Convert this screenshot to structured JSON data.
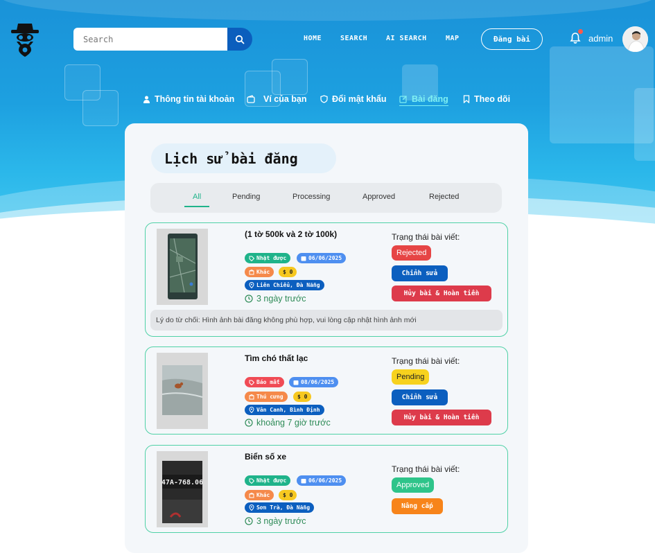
{
  "header": {
    "search_placeholder": "Search",
    "nav": [
      "HOME",
      "SEARCH",
      "AI SEARCH",
      "MAP"
    ],
    "post_button": "Đăng bài",
    "user": "admin"
  },
  "subnav": [
    {
      "label": "Thông tin tài khoản",
      "icon": "user-icon"
    },
    {
      "label": "Ví của bạn",
      "icon": "wallet-icon"
    },
    {
      "label": "Đổi mật khẩu",
      "icon": "shield-icon"
    },
    {
      "label": "Bài đăng",
      "icon": "edit-icon",
      "active": true
    },
    {
      "label": "Theo dõi",
      "icon": "bookmark-icon"
    }
  ],
  "page_title": "Lịch sử bài đăng",
  "tabs": [
    "All",
    "Pending",
    "Processing",
    "Approved",
    "Rejected"
  ],
  "active_tab": "All",
  "status_label": "Trạng thái bài viết:",
  "posts": [
    {
      "title": "(1 tờ 500k và 2 tờ 100k)",
      "type": "Nhặt được",
      "date": "06/06/2025",
      "category": "Khác",
      "price": "$ 0",
      "location": "Liên Chiểu, Đà Nẵng",
      "time": "3 ngày trước",
      "status": "Rejected",
      "actions": [
        "Chỉnh sửa",
        "Hủy bài & Hoàn tiền"
      ],
      "reason": "Lý do từ chối: Hình ảnh bài đăng không phù hợp, vui lòng cập nhật hình ảnh mới"
    },
    {
      "title": "Tìm chó thất lạc",
      "type": "Báo mất",
      "date": "08/06/2025",
      "category": "Thú cưng",
      "price": "$ 0",
      "location": "Vân Canh, Bình Định",
      "time": "khoảng 7 giờ trước",
      "status": "Pending",
      "actions": [
        "Chỉnh sửa",
        "Hủy bài & Hoàn tiền"
      ]
    },
    {
      "title": "Biển số xe",
      "type": "Nhặt được",
      "date": "06/06/2025",
      "category": "Khác",
      "price": "$ 0",
      "location": "Sơn Trà, Đà Nẵng",
      "time": "3 ngày trước",
      "status": "Approved",
      "actions": [
        "Nâng cấp"
      ],
      "plate_text": "47A-768.06"
    }
  ]
}
